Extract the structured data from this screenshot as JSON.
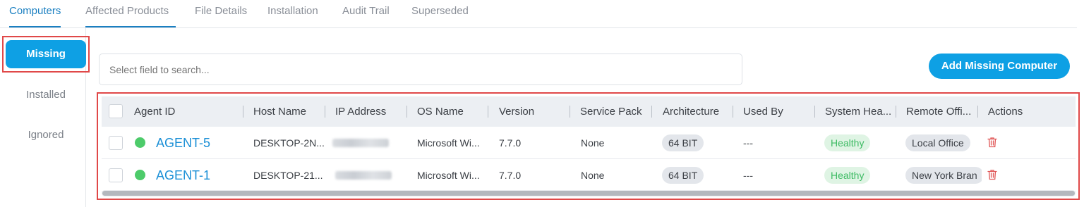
{
  "tabs": [
    {
      "label": "Computers",
      "active": true
    },
    {
      "label": "Affected Products",
      "active": false
    },
    {
      "label": "File Details",
      "active": false
    },
    {
      "label": "Installation",
      "active": false
    },
    {
      "label": "Audit Trail",
      "active": false
    },
    {
      "label": "Superseded",
      "active": false
    }
  ],
  "sidebar": {
    "items": [
      {
        "label": "Missing",
        "active": true
      },
      {
        "label": "Installed",
        "active": false
      },
      {
        "label": "Ignored",
        "active": false
      }
    ]
  },
  "search": {
    "placeholder": "Select field to search..."
  },
  "toolbar": {
    "add_label": "Add Missing Computer"
  },
  "table": {
    "columns": [
      "Agent ID",
      "Host Name",
      "IP Address",
      "OS Name",
      "Version",
      "Service Pack",
      "Architecture",
      "Used By",
      "System Hea...",
      "Remote Offi...",
      "Actions"
    ],
    "rows": [
      {
        "agent_id": "AGENT-5",
        "host_name": "DESKTOP-2N...",
        "os_name": "Microsoft Wi...",
        "version": "7.7.0",
        "service_pack": "None",
        "architecture": "64 BIT",
        "used_by": "---",
        "health": "Healthy",
        "remote_office": "Local Office"
      },
      {
        "agent_id": "AGENT-1",
        "host_name": "DESKTOP-21...",
        "os_name": "Microsoft Wi...",
        "version": "7.7.0",
        "service_pack": "None",
        "architecture": "64 BIT",
        "used_by": "---",
        "health": "Healthy",
        "remote_office": "New York Bran"
      }
    ]
  },
  "colors": {
    "accent": "#0ea0e4",
    "link": "#1a8fd6",
    "healthy": "#3dbb63",
    "highlight": "#e04848",
    "delete": "#e05555"
  },
  "icons": {
    "status": "online-dot-icon",
    "delete": "trash-icon"
  }
}
